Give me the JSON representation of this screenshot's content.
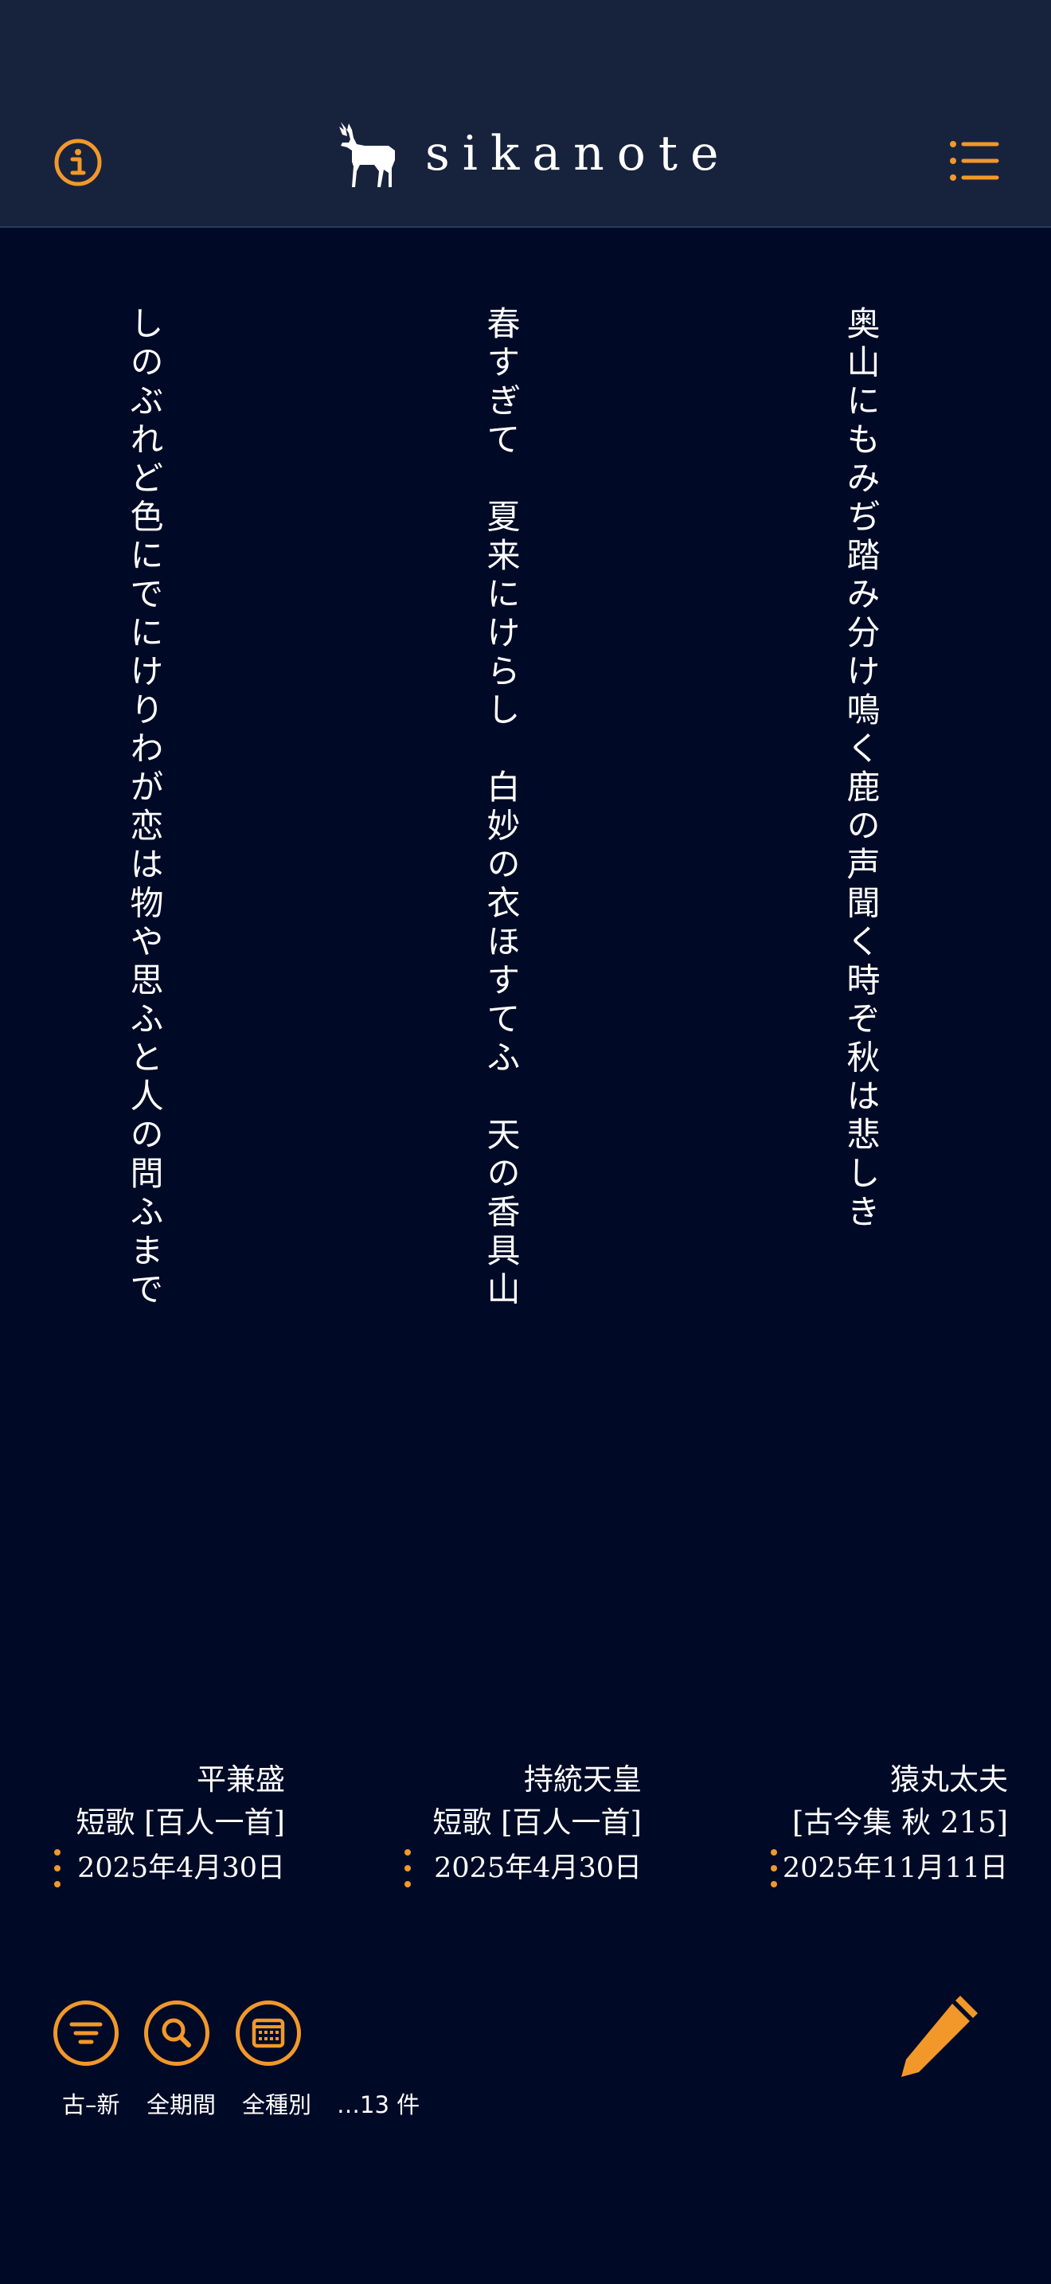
{
  "header": {
    "logo_text": "sikanote",
    "icons": [
      "info-icon",
      "deer-logo-icon",
      "list-menu-icon"
    ]
  },
  "poems": [
    {
      "text": "奥山にもみぢ踏み分け鳴く鹿の声聞く時ぞ秋は悲しき",
      "author": "猿丸太夫",
      "source": "[古今集 秋 215]",
      "date": "2025年11月11日"
    },
    {
      "text": "春すぎて　夏来にけらし　白妙の衣ほすてふ　天の香具山",
      "author": "持統天皇",
      "source": "短歌 [百人一首]",
      "date": "2025年4月30日"
    },
    {
      "text": "しのぶれど色にでにけりわが恋は物や思ふと人の問ふまで",
      "author": "平兼盛",
      "source": "短歌 [百人一首]",
      "date": "2025年4月30日"
    }
  ],
  "toolbar": {
    "order_label": "古–新",
    "period_label": "全期間",
    "type_label": "全種別",
    "count_label": "…13 件",
    "icons": [
      "filter-icon",
      "search-icon",
      "calendar-icon",
      "pencil-icon"
    ]
  },
  "colors": {
    "background": "#000a26",
    "header": "#17233d",
    "accent": "#f2982b",
    "text": "#ffffff"
  }
}
